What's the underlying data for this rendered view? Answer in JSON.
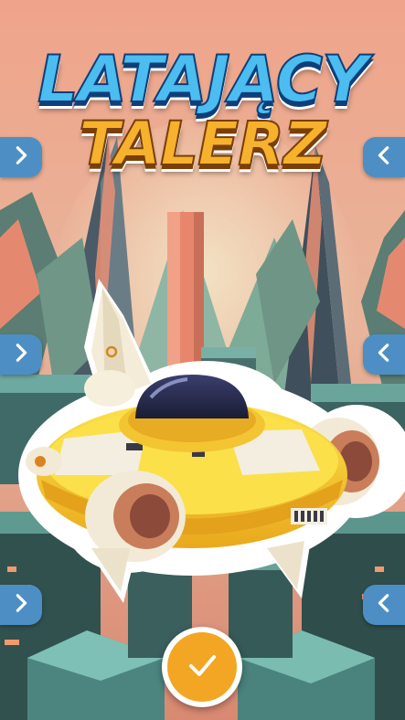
{
  "title": {
    "line1": "LATAJĄCY",
    "line2": "TALERZ"
  },
  "item": {
    "icon": "flying-saucer-sticker"
  },
  "icons": {
    "next": "chevron-right-icon",
    "previous": "chevron-left-icon",
    "confirm": "check-icon"
  },
  "colors": {
    "title_primary": "#4bbdf0",
    "title_secondary": "#f6b22c",
    "arrow_button": "#4d8fc4",
    "confirm_button": "#f2a623",
    "saucer_body": "#f4cf2a"
  }
}
